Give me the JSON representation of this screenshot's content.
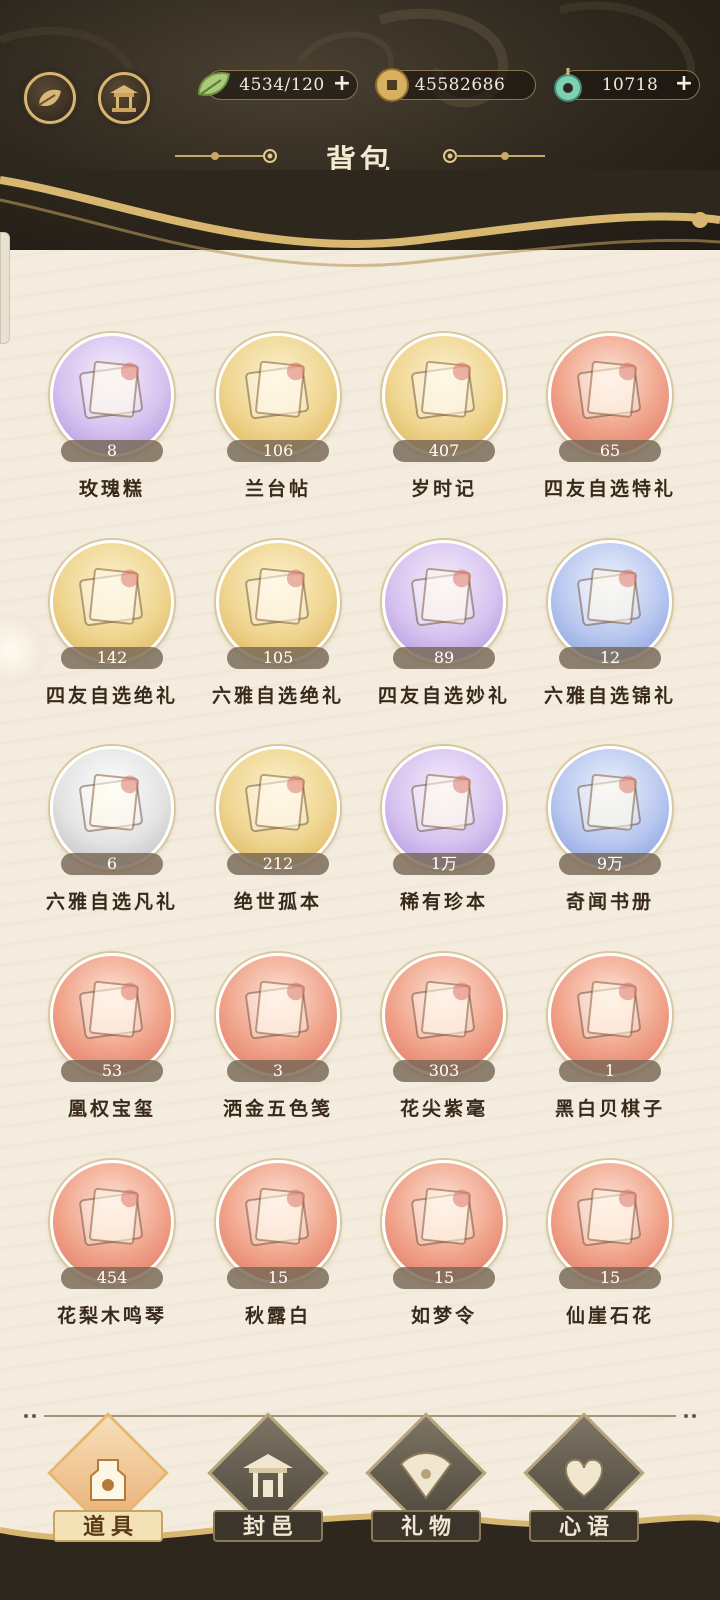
{
  "header": {
    "title": "背包",
    "resources": [
      {
        "icon": "leaf-stamina-icon",
        "value": "4534/120",
        "has_plus": true
      },
      {
        "icon": "copper-coin-icon",
        "value": "45582686",
        "has_plus": false
      },
      {
        "icon": "jade-pendant-icon",
        "value": "10718",
        "has_plus": true
      }
    ],
    "left_buttons": [
      "ginkgo-leaf-icon",
      "pavilion-icon"
    ],
    "plus_symbol": "+"
  },
  "items": [
    {
      "name": "玫瑰糕",
      "count": "8",
      "color": "purple",
      "icon": "rose-cake-icon"
    },
    {
      "name": "兰台帖",
      "count": "106",
      "color": "gold",
      "icon": "orchid-letter-icon"
    },
    {
      "name": "岁时记",
      "count": "407",
      "color": "gold",
      "icon": "almanac-book-icon"
    },
    {
      "name": "四友自选特礼",
      "count": "65",
      "color": "red",
      "icon": "gift-box-icon"
    },
    {
      "name": "四友自选绝礼",
      "count": "142",
      "color": "gold",
      "icon": "scroll-chest-icon"
    },
    {
      "name": "六雅自选绝礼",
      "count": "105",
      "color": "gold",
      "icon": "jewel-box-icon"
    },
    {
      "name": "四友自选妙礼",
      "count": "89",
      "color": "purple",
      "icon": "go-box-icon"
    },
    {
      "name": "六雅自选锦礼",
      "count": "12",
      "color": "blue",
      "icon": "flower-chest-icon"
    },
    {
      "name": "六雅自选凡礼",
      "count": "6",
      "color": "silver",
      "icon": "pouch-icon"
    },
    {
      "name": "绝世孤本",
      "count": "212",
      "color": "gold",
      "icon": "unique-book-icon"
    },
    {
      "name": "稀有珍本",
      "count": "1万",
      "color": "purple",
      "icon": "rare-book-icon"
    },
    {
      "name": "奇闻书册",
      "count": "9万",
      "color": "blue",
      "icon": "tale-book-icon"
    },
    {
      "name": "凰权宝玺",
      "count": "53",
      "color": "red",
      "icon": "phoenix-seal-icon"
    },
    {
      "name": "洒金五色笺",
      "count": "3",
      "color": "red",
      "icon": "gold-paper-icon"
    },
    {
      "name": "花尖紫毫",
      "count": "303",
      "color": "red",
      "icon": "brush-icon"
    },
    {
      "name": "黑白贝棋子",
      "count": "1",
      "color": "red",
      "icon": "go-stones-icon"
    },
    {
      "name": "花梨木鸣琴",
      "count": "454",
      "color": "red",
      "icon": "zither-icon"
    },
    {
      "name": "秋露白",
      "count": "15",
      "color": "red",
      "icon": "wine-vase-icon"
    },
    {
      "name": "如梦令",
      "count": "15",
      "color": "red",
      "icon": "fan-icon"
    },
    {
      "name": "仙崖石花",
      "count": "15",
      "color": "red",
      "icon": "teapot-icon"
    }
  ],
  "tabs": [
    {
      "label": "道具",
      "active": true,
      "icon": "props-vase-icon"
    },
    {
      "label": "封邑",
      "active": false,
      "icon": "palace-icon"
    },
    {
      "label": "礼物",
      "active": false,
      "icon": "folding-fan-icon"
    },
    {
      "label": "心语",
      "active": false,
      "icon": "heart-knot-icon"
    }
  ],
  "colors": {
    "header_dark": "#2e271d",
    "gold_accent": "#d5b574",
    "parchment": "#f3ecdd",
    "text_dark": "#3a2a1c",
    "count_badge": "#786856"
  }
}
